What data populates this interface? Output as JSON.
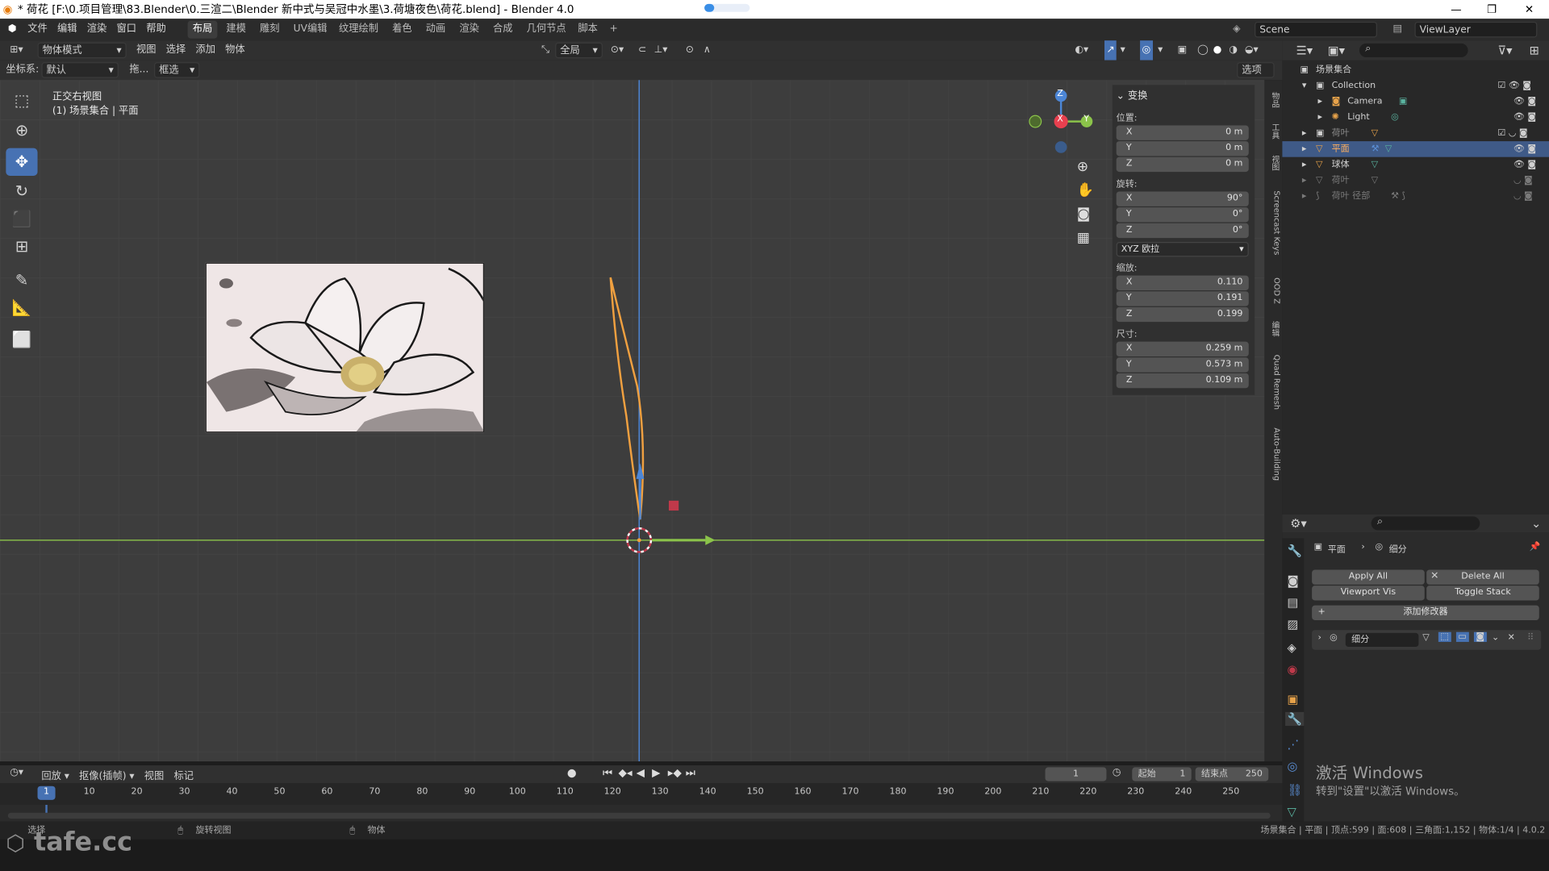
{
  "window": {
    "title": "* 荷花 [F:\\0.项目管理\\83.Blender\\0.三渲二\\Blender 新中式与吴冠中水墨\\3.荷塘夜色\\荷花.blend] - Blender 4.0",
    "minimize": "—",
    "maximize": "❐",
    "close": "✕"
  },
  "menu": [
    "文件",
    "编辑",
    "渲染",
    "窗口",
    "帮助"
  ],
  "workspaces": [
    "布局",
    "建模",
    "雕刻",
    "UV编辑",
    "纹理绘制",
    "着色",
    "动画",
    "渲染",
    "合成",
    "几何节点",
    "脚本"
  ],
  "workspace_add": "+",
  "scene": {
    "label": "Scene",
    "viewlayer": "ViewLayer"
  },
  "header": {
    "mode": "物体模式",
    "menus": [
      "视图",
      "选择",
      "添加",
      "物体"
    ],
    "orientation": "全局",
    "options": "选项"
  },
  "header2": {
    "coord_label": "坐标系:",
    "coord_value": "默认",
    "drag_label": "拖...",
    "select_mode": "框选"
  },
  "viewport": {
    "view_name": "正交右视图",
    "collection_info": "(1) 场景集合 | 平面",
    "gizmo": {
      "z": "Z",
      "x": "X",
      "y": "Y"
    }
  },
  "npanel": {
    "section": "变换",
    "location_label": "位置:",
    "location": [
      {
        "axis": "X",
        "value": "0 m"
      },
      {
        "axis": "Y",
        "value": "0 m"
      },
      {
        "axis": "Z",
        "value": "0 m"
      }
    ],
    "rotation_label": "旋转:",
    "rotation": [
      {
        "axis": "X",
        "value": "90°"
      },
      {
        "axis": "Y",
        "value": "0°"
      },
      {
        "axis": "Z",
        "value": "0°"
      }
    ],
    "rotation_mode": "XYZ 欧拉",
    "scale_label": "缩放:",
    "scale": [
      {
        "axis": "X",
        "value": "0.110"
      },
      {
        "axis": "Y",
        "value": "0.191"
      },
      {
        "axis": "Z",
        "value": "0.199"
      }
    ],
    "dimensions_label": "尺寸:",
    "dimensions": [
      {
        "axis": "X",
        "value": "0.259 m"
      },
      {
        "axis": "Y",
        "value": "0.573 m"
      },
      {
        "axis": "Z",
        "value": "0.109 m"
      }
    ]
  },
  "side_tabs": [
    "物品",
    "工具",
    "视图",
    "Screencast Keys",
    "OOD Z",
    "编辑",
    "Quad Remesh",
    "Auto-Building"
  ],
  "outliner": {
    "rows": [
      {
        "label": "场景集合",
        "indent": 0
      },
      {
        "label": "Collection",
        "indent": 1
      },
      {
        "label": "Camera",
        "indent": 2
      },
      {
        "label": "Light",
        "indent": 2
      },
      {
        "label": "荷叶",
        "indent": 1
      },
      {
        "label": "平面",
        "indent": 1
      },
      {
        "label": "球体",
        "indent": 1
      },
      {
        "label": "荷叶",
        "indent": 1
      },
      {
        "label": "荷叶 径部",
        "indent": 1
      }
    ]
  },
  "properties": {
    "breadcrumb_object": "平面",
    "breadcrumb_sep": "›",
    "breadcrumb_modifier": "细分",
    "apply_all": "Apply All",
    "delete_all": "Delete All",
    "viewport_vis": "Viewport Vis",
    "toggle_stack": "Toggle Stack",
    "add_modifier": "添加修改器",
    "modifier_name": "细分"
  },
  "activate_windows": {
    "title": "激活 Windows",
    "subtitle": "转到\"设置\"以激活 Windows。"
  },
  "timeline": {
    "playback": "回放",
    "keying": "抠像(插帧)",
    "view": "视图",
    "marker": "标记",
    "current_frame": "1",
    "start_label": "起始",
    "start_value": "1",
    "end_label": "结束点",
    "end_value": "250",
    "ticks": [
      "1",
      "10",
      "20",
      "30",
      "40",
      "50",
      "60",
      "70",
      "80",
      "90",
      "100",
      "110",
      "120",
      "130",
      "140",
      "150",
      "160",
      "170",
      "180",
      "190",
      "200",
      "210",
      "220",
      "230",
      "240",
      "250"
    ]
  },
  "status": {
    "select": "选择",
    "rotate_view": "旋转视图",
    "object": "物体",
    "stats": "场景集合 | 平面 | 顶点:599 | 面:608 | 三角面:1,152 | 物体:1/4 | 4.0.2"
  },
  "watermark": "tafe.cc",
  "colors": {
    "accent": "#4772b3",
    "x_axis": "#e8404f",
    "y_axis": "#8bc34a",
    "z_axis": "#4c86d6",
    "curve": "#f0a040"
  }
}
